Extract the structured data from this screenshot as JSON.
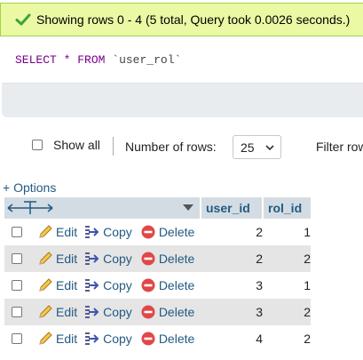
{
  "success_message": "Showing rows 0 - 4 (5 total, Query took 0.0026 seconds.)",
  "sql": {
    "select": "SELECT",
    "star": "*",
    "from": "FROM",
    "table": "`user_rol`"
  },
  "nav": {
    "show_all_label": "Show all",
    "number_of_rows_label": "Number of rows:",
    "rows_selected": "25",
    "filter_label": "Filter rows"
  },
  "options_link": "+ Options",
  "table": {
    "columns": [
      "user_id",
      "rol_id"
    ],
    "actions": {
      "edit": "Edit",
      "copy": "Copy",
      "delete": "Delete"
    },
    "rows": [
      {
        "user_id": "2",
        "rol_id": "1"
      },
      {
        "user_id": "2",
        "rol_id": "2"
      },
      {
        "user_id": "3",
        "rol_id": "1"
      },
      {
        "user_id": "3",
        "rol_id": "2"
      },
      {
        "user_id": "4",
        "rol_id": "2"
      }
    ]
  },
  "colors": {
    "link": "#235a81",
    "success_bg": "#ebf8a4",
    "header_bg": "#d3dce3",
    "even_row": "#e5e5e5"
  }
}
